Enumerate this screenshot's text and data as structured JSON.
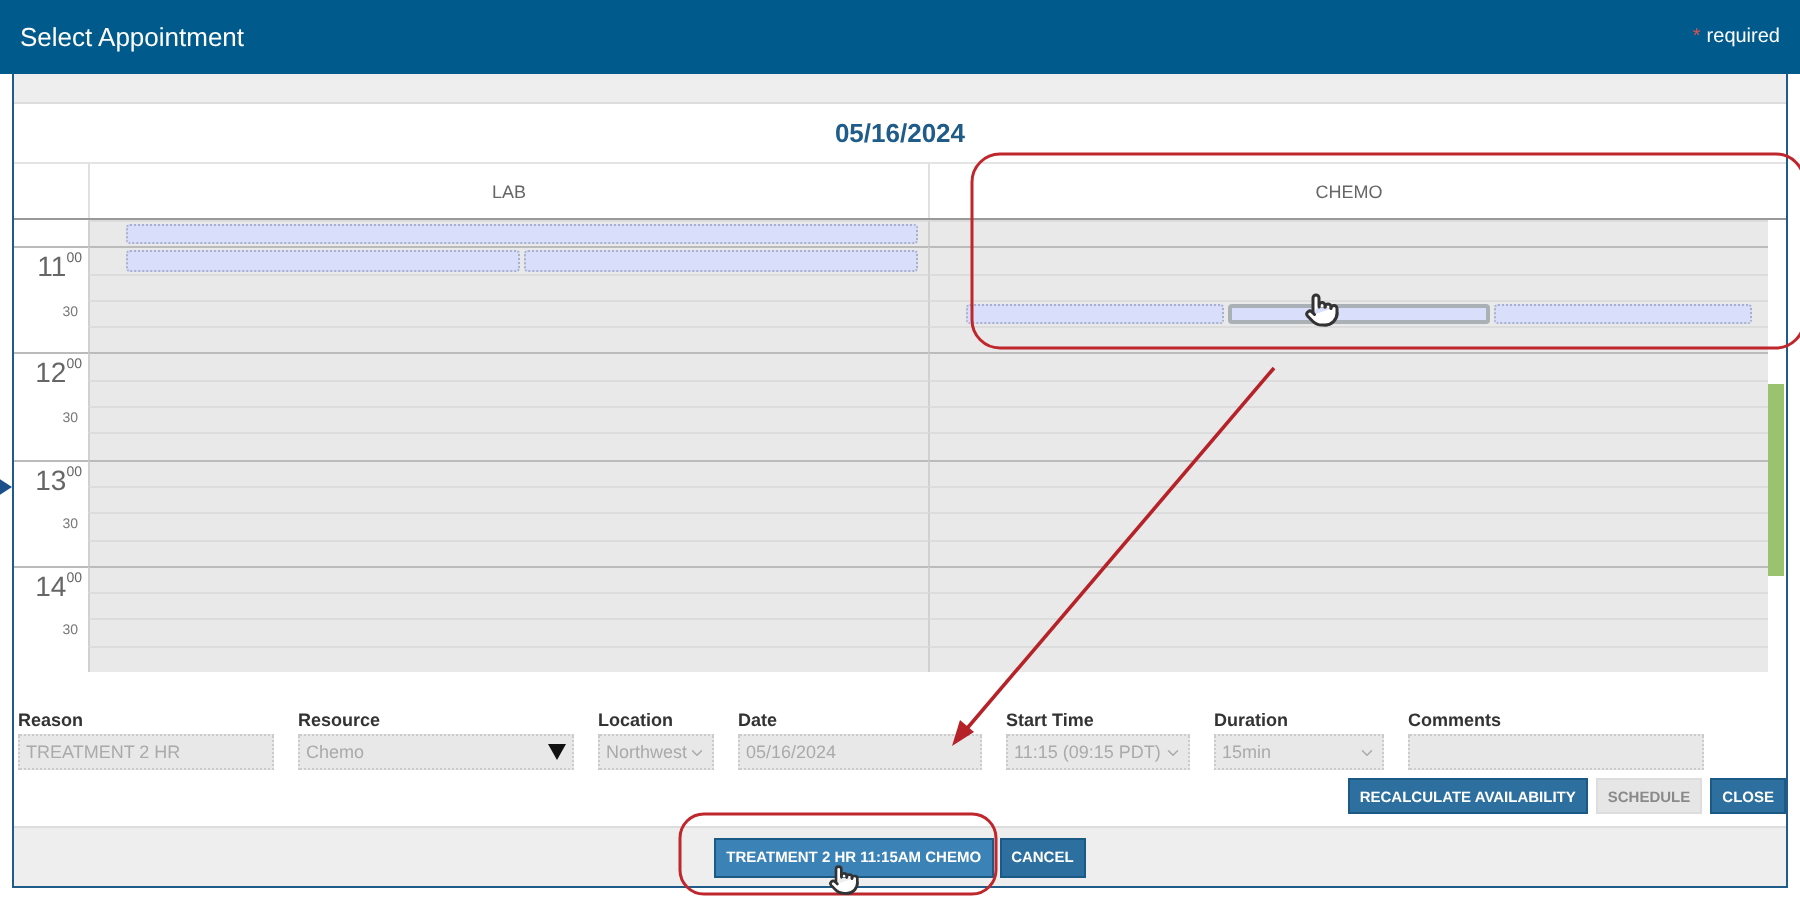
{
  "window": {
    "title": "Select Appointment",
    "required_mark": "*",
    "required_label": "required"
  },
  "date": "05/16/2024",
  "columns": [
    {
      "label": "LAB"
    },
    {
      "label": "CHEMO",
      "highlighted": true
    }
  ],
  "time_rows": [
    {
      "kind": "quarter",
      "cells": [
        {
          "kind": "slots",
          "slots": [
            {
              "selected": false
            }
          ]
        },
        {
          "kind": "empty"
        }
      ]
    },
    {
      "kind": "hour",
      "label": "11$^{00}$",
      "cells": [
        {
          "kind": "slots",
          "slots": [
            {
              "selected": false
            },
            {
              "selected": false
            }
          ]
        },
        {
          "kind": "empty"
        }
      ]
    },
    {
      "kind": "quarter"
    },
    {
      "kind": "half",
      "label": "30",
      "cells": [
        {
          "kind": "empty"
        },
        {
          "kind": "slots",
          "slots": [
            {
              "selected": false
            },
            {
              "selected": true
            },
            {
              "selected": false
            }
          ]
        }
      ]
    },
    {
      "kind": "quarter"
    },
    {
      "kind": "hour",
      "label": "12$^{00}$"
    },
    {
      "kind": "quarter"
    },
    {
      "kind": "half",
      "label": "30"
    },
    {
      "kind": "quarter"
    },
    {
      "kind": "hour",
      "label": "13$^{00}$",
      "current": true
    },
    {
      "kind": "quarter"
    },
    {
      "kind": "half",
      "label": "30"
    },
    {
      "kind": "quarter"
    },
    {
      "kind": "hour",
      "label": "14$^{00}$"
    },
    {
      "kind": "quarter"
    },
    {
      "kind": "half",
      "label": "30"
    },
    {
      "kind": "quarter"
    }
  ],
  "fields": [
    {
      "label": "Reason",
      "kind": "text",
      "value": "TREATMENT 2 HR",
      "disabled": true
    },
    {
      "label": "Resource",
      "kind": "dropdown",
      "value": "Chemo",
      "disabled": true
    },
    {
      "label": "Location",
      "kind": "select",
      "value": "Northwest",
      "disabled": true
    },
    {
      "label": "Date",
      "kind": "text",
      "value": "05/16/2024",
      "disabled": true
    },
    {
      "label": "Start Time",
      "kind": "select",
      "value": "11:15 (09:15 PDT)",
      "disabled": true
    },
    {
      "label": "Duration",
      "kind": "select",
      "value": "15min",
      "disabled": true
    },
    {
      "label": "Comments",
      "kind": "text",
      "disabled": true
    }
  ],
  "actions": [
    {
      "label": "RECALCULATE AVAILABILITY",
      "disabled": false
    },
    {
      "label": "SCHEDULE",
      "disabled": true
    },
    {
      "label": "CLOSE",
      "disabled": false
    }
  ],
  "footer_buttons": [
    {
      "label": "TREATMENT 2 HR 11:15AM CHEMO",
      "highlighted": true
    },
    {
      "label": "CANCEL",
      "highlighted": false
    }
  ]
}
